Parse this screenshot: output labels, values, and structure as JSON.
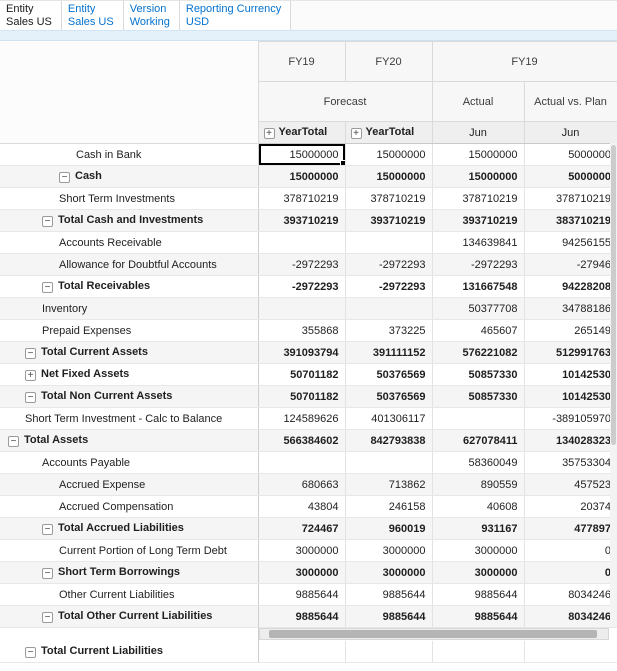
{
  "pov": {
    "tabs": [
      {
        "dimension": "Entity",
        "member": "Sales US",
        "active": true
      },
      {
        "dimension": "Entity",
        "member": "Sales US",
        "active": false
      },
      {
        "dimension": "Version",
        "member": "Working",
        "active": false
      },
      {
        "dimension": "Reporting Currency",
        "member": "USD",
        "active": false
      }
    ]
  },
  "icons": {
    "expand": "+",
    "collapse": "−"
  },
  "grid": {
    "header": {
      "years": [
        {
          "label": "FY19",
          "span": 1
        },
        {
          "label": "FY20",
          "span": 1
        },
        {
          "label": "FY19",
          "span": 2
        }
      ],
      "scenarios": [
        {
          "label": "Forecast",
          "span": 2
        },
        {
          "label": "Actual",
          "span": 1
        },
        {
          "label": "Actual vs. Plan",
          "span": 1
        }
      ],
      "periods": [
        {
          "label": "YearTotal",
          "icon": "expand"
        },
        {
          "label": "YearTotal",
          "icon": "expand"
        },
        {
          "label": "Jun",
          "icon": null
        },
        {
          "label": "Jun",
          "icon": null
        }
      ]
    },
    "selection": {
      "row": 0,
      "col": 0
    },
    "rows": [
      {
        "label": "Cash in Bank",
        "depth": 4,
        "icon": null,
        "bold": false,
        "values": [
          "15000000",
          "15000000",
          "15000000",
          "5000000"
        ]
      },
      {
        "label": "Cash",
        "depth": 3,
        "icon": "collapse",
        "bold": true,
        "values": [
          "15000000",
          "15000000",
          "15000000",
          "5000000"
        ]
      },
      {
        "label": "Short Term Investments",
        "depth": 3,
        "icon": null,
        "bold": false,
        "values": [
          "378710219",
          "378710219",
          "378710219",
          "378710219"
        ]
      },
      {
        "label": "Total Cash and Investments",
        "depth": 2,
        "icon": "collapse",
        "bold": true,
        "values": [
          "393710219",
          "393710219",
          "393710219",
          "383710219"
        ]
      },
      {
        "label": "Accounts Receivable",
        "depth": 3,
        "icon": null,
        "bold": false,
        "values": [
          "",
          "",
          "134639841",
          "94256155"
        ]
      },
      {
        "label": "Allowance for Doubtful Accounts",
        "depth": 3,
        "icon": null,
        "bold": false,
        "values": [
          "-2972293",
          "-2972293",
          "-2972293",
          "-27946"
        ]
      },
      {
        "label": "Total Receivables",
        "depth": 2,
        "icon": "collapse",
        "bold": true,
        "values": [
          "-2972293",
          "-2972293",
          "131667548",
          "94228208"
        ]
      },
      {
        "label": "Inventory",
        "depth": 2,
        "icon": null,
        "bold": false,
        "values": [
          "",
          "",
          "50377708",
          "34788186"
        ]
      },
      {
        "label": "Prepaid Expenses",
        "depth": 2,
        "icon": null,
        "bold": false,
        "values": [
          "355868",
          "373225",
          "465607",
          "265149"
        ]
      },
      {
        "label": "Total Current Assets",
        "depth": 1,
        "icon": "collapse",
        "bold": true,
        "values": [
          "391093794",
          "391111152",
          "576221082",
          "512991763"
        ]
      },
      {
        "label": "Net Fixed Assets",
        "depth": 1,
        "icon": "expand",
        "bold": true,
        "values": [
          "50701182",
          "50376569",
          "50857330",
          "10142530"
        ]
      },
      {
        "label": "Total Non Current Assets",
        "depth": 1,
        "icon": "collapse",
        "bold": true,
        "values": [
          "50701182",
          "50376569",
          "50857330",
          "10142530"
        ]
      },
      {
        "label": "Short Term Investment - Calc to Balance",
        "depth": 1,
        "icon": null,
        "bold": false,
        "values": [
          "124589626",
          "401306117",
          "",
          "-389105970"
        ]
      },
      {
        "label": "Total Assets",
        "depth": 0,
        "icon": "collapse",
        "bold": true,
        "values": [
          "566384602",
          "842793838",
          "627078411",
          "134028323"
        ]
      },
      {
        "label": "Accounts Payable",
        "depth": 2,
        "icon": null,
        "bold": false,
        "values": [
          "",
          "",
          "58360049",
          "35753304"
        ]
      },
      {
        "label": "Accrued Expense",
        "depth": 3,
        "icon": null,
        "bold": false,
        "values": [
          "680663",
          "713862",
          "890559",
          "457523"
        ]
      },
      {
        "label": "Accrued Compensation",
        "depth": 3,
        "icon": null,
        "bold": false,
        "values": [
          "43804",
          "246158",
          "40608",
          "20374"
        ]
      },
      {
        "label": "Total Accrued Liabilities",
        "depth": 2,
        "icon": "collapse",
        "bold": true,
        "values": [
          "724467",
          "960019",
          "931167",
          "477897"
        ]
      },
      {
        "label": "Current Portion of Long Term Debt",
        "depth": 3,
        "icon": null,
        "bold": false,
        "values": [
          "3000000",
          "3000000",
          "3000000",
          "0"
        ]
      },
      {
        "label": "Short Term Borrowings",
        "depth": 2,
        "icon": "collapse",
        "bold": true,
        "values": [
          "3000000",
          "3000000",
          "3000000",
          "0"
        ]
      },
      {
        "label": "Other Current Liabilities",
        "depth": 3,
        "icon": null,
        "bold": false,
        "values": [
          "9885644",
          "9885644",
          "9885644",
          "8034246"
        ]
      },
      {
        "label": "Total Other Current Liabilities",
        "depth": 2,
        "icon": "collapse",
        "bold": true,
        "values": [
          "9885644",
          "9885644",
          "9885644",
          "8034246"
        ]
      },
      {
        "label": "Total Current Liabilities",
        "depth": 1,
        "icon": "collapse",
        "bold": true,
        "values": [
          "",
          "",
          "",
          ""
        ]
      }
    ]
  }
}
